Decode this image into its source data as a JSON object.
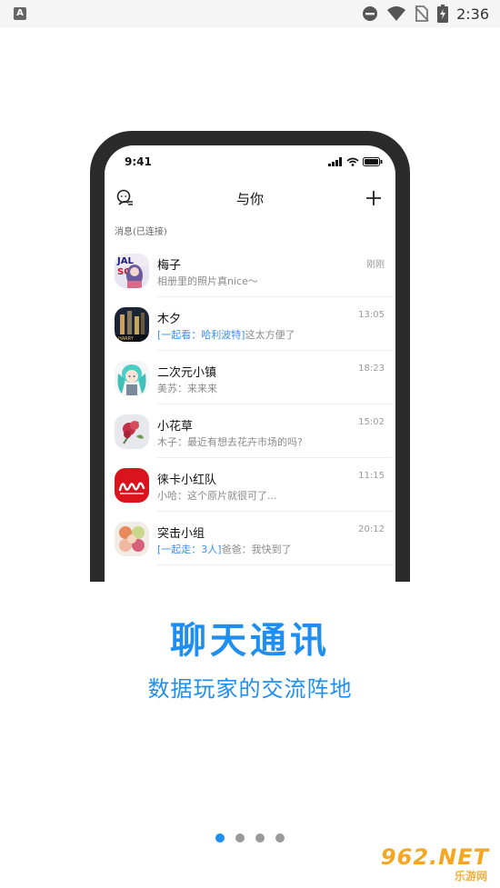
{
  "status_bar": {
    "time": "2:36",
    "icons": [
      "app-notification-icon",
      "do-not-disturb-icon",
      "wifi-icon",
      "no-sim-icon",
      "battery-icon"
    ]
  },
  "phone": {
    "status_time": "9:41",
    "header": {
      "title": "与你",
      "left_icon": "profile-icon",
      "right_icon": "plus-icon"
    },
    "section_label": "消息(已连接)",
    "chats": [
      {
        "name": "梅子",
        "preview_highlight": "",
        "preview_text": "相册里的照片真nice～",
        "time": "刚刚",
        "avatar": "girl-poster"
      },
      {
        "name": "木夕",
        "preview_highlight": "[一起看：哈利波特]",
        "preview_text": "这太方便了",
        "time": "13:05",
        "avatar": "movie-poster"
      },
      {
        "name": "二次元小镇",
        "preview_highlight": "",
        "preview_text": "美苏：来来来",
        "time": "18:23",
        "avatar": "anime-girl"
      },
      {
        "name": "小花草",
        "preview_highlight": "",
        "preview_text": "木子：最近有想去花卉市场的吗?",
        "time": "15:02",
        "avatar": "flower"
      },
      {
        "name": "徕卡小红队",
        "preview_highlight": "",
        "preview_text": "小哈：这个原片就很可了...",
        "time": "11:15",
        "avatar": "leica-logo"
      },
      {
        "name": "突击小组",
        "preview_highlight": "[一起走：3人]",
        "preview_text": "爸爸：我快到了",
        "time": "20:12",
        "avatar": "macarons"
      }
    ]
  },
  "headline": "聊天通讯",
  "subline": "数据玩家的交流阵地",
  "pagination": {
    "count": 4,
    "active_index": 0
  },
  "watermark": {
    "main": "962.NET",
    "sub": "乐游网"
  },
  "colors": {
    "accent": "#1e8ef0",
    "phone_frame": "#2b2b2b",
    "highlight_text": "#3b8ef0",
    "leica_red": "#d9141c"
  }
}
